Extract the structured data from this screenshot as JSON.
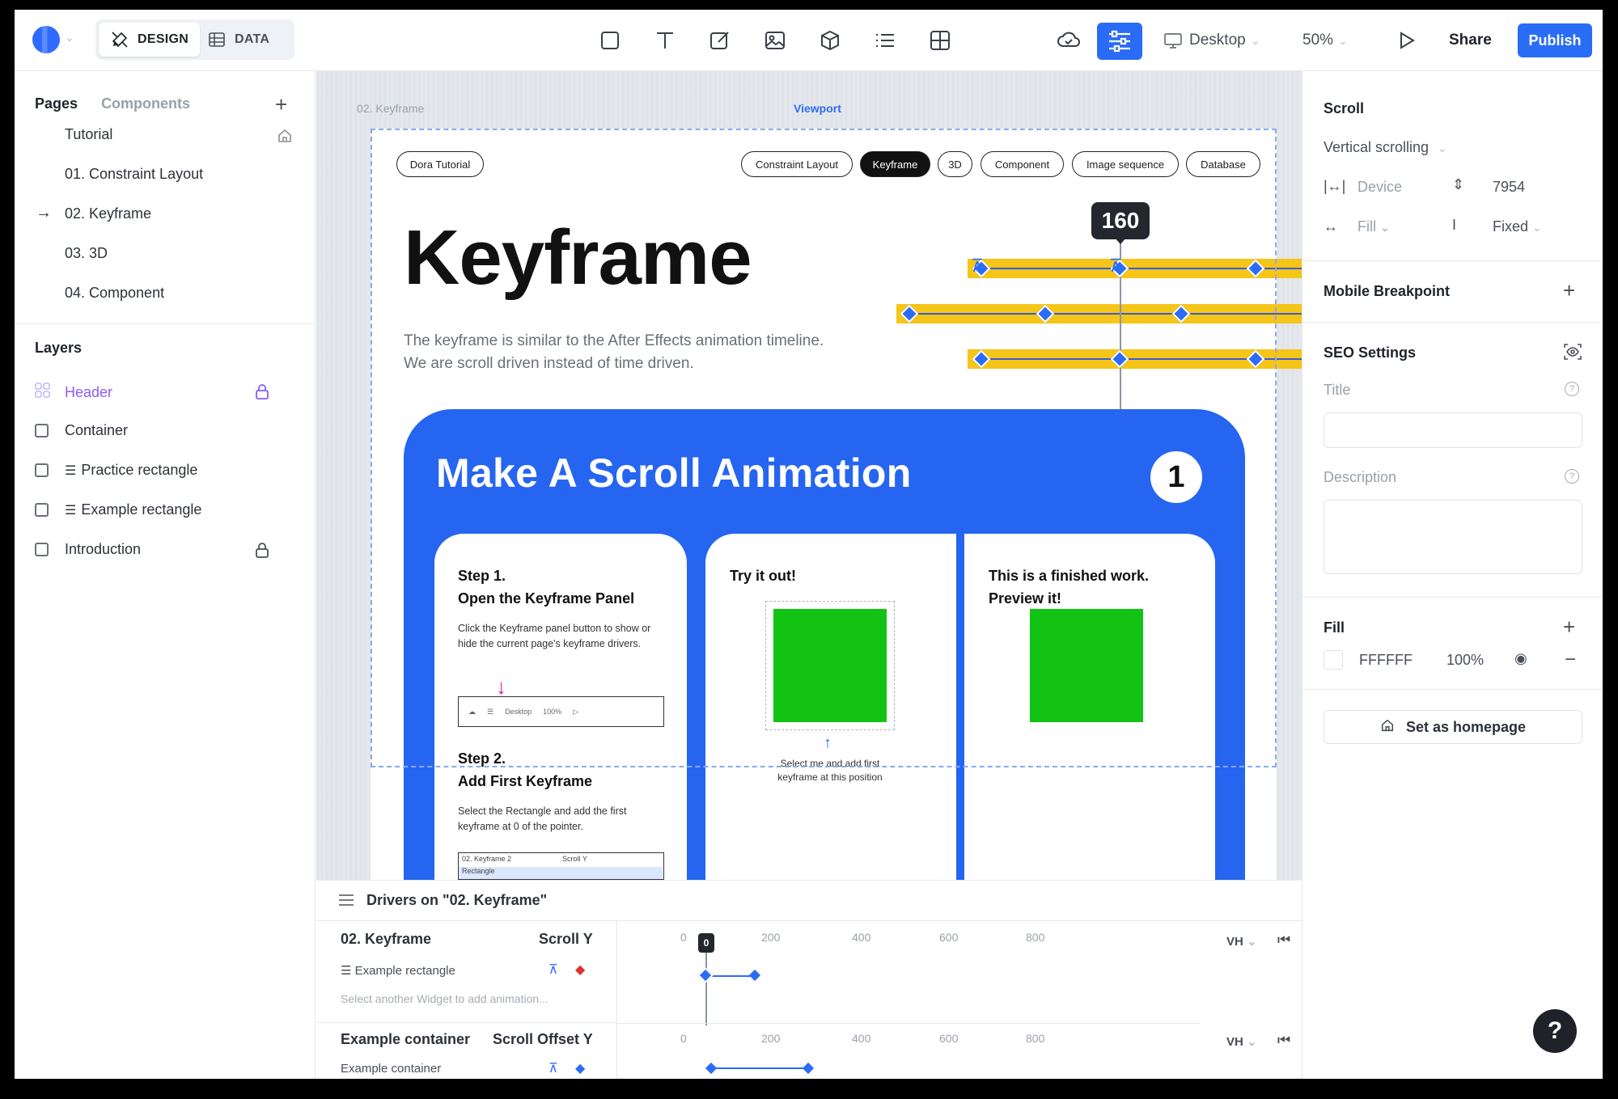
{
  "topbar": {
    "mode_design": "DESIGN",
    "mode_data": "DATA",
    "device": "Desktop",
    "zoom": "50%",
    "share": "Share",
    "publish": "Publish"
  },
  "left": {
    "tab_pages": "Pages",
    "tab_components": "Components",
    "pages": [
      "Tutorial",
      "01. Constraint Layout",
      "02. Keyframe",
      "03. 3D",
      "04. Component"
    ],
    "layers_title": "Layers",
    "layers": [
      "Header",
      "Container",
      "Practice rectangle",
      "Example rectangle",
      "Introduction"
    ]
  },
  "canvas": {
    "page_label": "02. Keyframe",
    "viewport_label": "Viewport",
    "nav_left": "Dora Tutorial",
    "nav": [
      "Constraint Layout",
      "Keyframe",
      "3D",
      "Component",
      "Image sequence",
      "Database"
    ],
    "hero_title": "Keyframe",
    "hero_desc_1": "The keyframe is similar to the After Effects animation timeline.",
    "hero_desc_2": "We are scroll driven instead of time driven.",
    "playhead_value": "160",
    "card_title": "Make A Scroll Animation",
    "card_number": "1",
    "step1_h1": "Step 1.",
    "step1_h2": "Open the Keyframe Panel",
    "step1_p": "Click the Keyframe panel button to show or hide the current page's keyframe drivers.",
    "mini_device": "Desktop",
    "mini_zoom": "100%",
    "step2_h1": "Step 2.",
    "step2_h2": "Add First Keyframe",
    "step2_p": "Select the Rectangle and add the first keyframe at 0 of the pointer.",
    "mini2_col1": "02. Keyframe 2",
    "mini2_col2": "Scroll Y",
    "mini2_row": "Rectangle",
    "try_title": "Try it out!",
    "try_caption_1": "Select me and add first",
    "try_caption_2": "keyframe at this position",
    "finished_1": "This is a finished work.",
    "finished_2": "Preview it!"
  },
  "drivers": {
    "header": "Drivers on \"02. Keyframe\"",
    "row1_name": "02. Keyframe",
    "row1_type": "Scroll Y",
    "row1_item": "Example rectangle",
    "row1_hint": "Select another Widget to add animation...",
    "row1_playhead": "0",
    "row2_name": "Example container",
    "row2_type": "Scroll Offset Y",
    "row2_item": "Example container",
    "unit": "VH",
    "ticks": [
      "0",
      "200",
      "400",
      "600",
      "800"
    ]
  },
  "right": {
    "scroll_title": "Scroll",
    "scroll_mode": "Vertical scrolling",
    "device_label": "Device",
    "height_value": "7954",
    "fill_w": "Fill",
    "fixed": "Fixed",
    "mobile_bp": "Mobile Breakpoint",
    "seo_title": "SEO Settings",
    "title_label": "Title",
    "desc_label": "Description",
    "fill_title": "Fill",
    "fill_hex": "FFFFFF",
    "fill_opacity": "100%",
    "homepage": "Set as homepage"
  },
  "colors": {
    "accent": "#2b6cf6",
    "keyframe_track": "#f5c518",
    "green": "#13c313",
    "layer_selected": "#8b5cf6"
  }
}
